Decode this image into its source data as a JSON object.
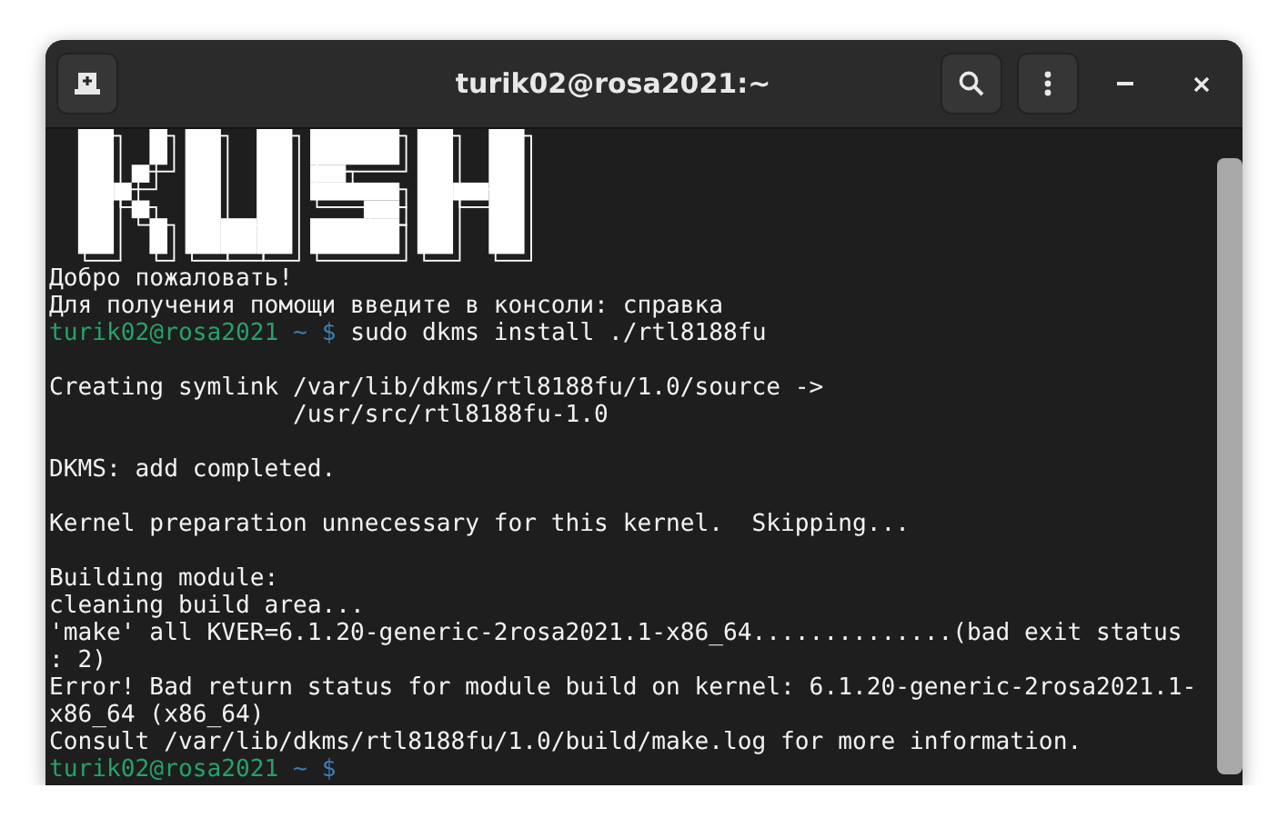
{
  "window": {
    "title": "turik02@rosa2021:~"
  },
  "terminal": {
    "lines": [
      {
        "kind": "text",
        "text": "Добро пожаловать!"
      },
      {
        "kind": "text",
        "text": "Для получения помощи введите в консоли: справка"
      },
      {
        "kind": "prompt",
        "user": "turik02@rosa2021",
        "path": "~",
        "symbol": "$",
        "command": "sudo dkms install ./rtl8188fu"
      },
      {
        "kind": "blank"
      },
      {
        "kind": "text",
        "text": "Creating symlink /var/lib/dkms/rtl8188fu/1.0/source ->"
      },
      {
        "kind": "text",
        "text": "                 /usr/src/rtl8188fu-1.0"
      },
      {
        "kind": "blank"
      },
      {
        "kind": "text",
        "text": "DKMS: add completed."
      },
      {
        "kind": "blank"
      },
      {
        "kind": "text",
        "text": "Kernel preparation unnecessary for this kernel.  Skipping..."
      },
      {
        "kind": "blank"
      },
      {
        "kind": "text",
        "text": "Building module:"
      },
      {
        "kind": "text",
        "text": "cleaning build area..."
      },
      {
        "kind": "text",
        "text": "'make' all KVER=6.1.20-generic-2rosa2021.1-x86_64..............(bad exit status"
      },
      {
        "kind": "text",
        "text": ": 2)"
      },
      {
        "kind": "text",
        "text": "Error! Bad return status for module build on kernel: 6.1.20-generic-2rosa2021.1-"
      },
      {
        "kind": "text",
        "text": "x86_64 (x86_64)"
      },
      {
        "kind": "text",
        "text": "Consult /var/lib/dkms/rtl8188fu/1.0/build/make.log for more information."
      },
      {
        "kind": "prompt",
        "user": "turik02@rosa2021",
        "path": "~",
        "symbol": "$"
      }
    ]
  }
}
